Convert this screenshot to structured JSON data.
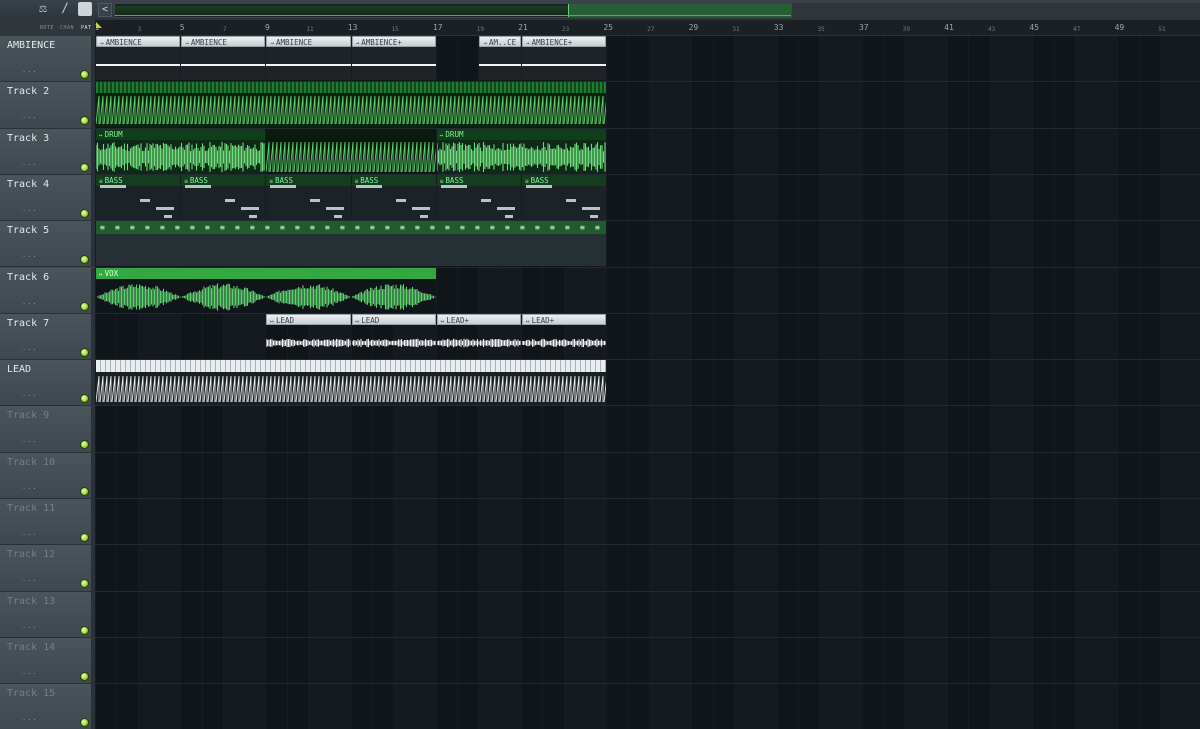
{
  "toolbar": {
    "icons": [
      "note-icon",
      "chan-icon",
      "pattern-icon"
    ],
    "note_label": "NOTE",
    "chan_label": "CHAN",
    "pat_label": "PAT",
    "overview_arrow": "<"
  },
  "ruler": {
    "major": [
      "1",
      "5",
      "9",
      "13",
      "17",
      "21",
      "25",
      "29",
      "33",
      "37",
      "41",
      "45",
      "49"
    ],
    "minor": [
      "3",
      "7",
      "11",
      "15",
      "19",
      "23",
      "27",
      "31",
      "35",
      "39",
      "43",
      "47",
      "51"
    ]
  },
  "tracks": [
    {
      "name": "AMBIENCE",
      "dots": "..."
    },
    {
      "name": "Track 2",
      "dots": "..."
    },
    {
      "name": "Track 3",
      "dots": "..."
    },
    {
      "name": "Track 4",
      "dots": "..."
    },
    {
      "name": "Track 5",
      "dots": "..."
    },
    {
      "name": "Track 6",
      "dots": "..."
    },
    {
      "name": "Track 7",
      "dots": "..."
    },
    {
      "name": "LEAD",
      "dots": "..."
    },
    {
      "name": "Track 9",
      "dots": "..."
    },
    {
      "name": "Track 10",
      "dots": "..."
    },
    {
      "name": "Track 11",
      "dots": "..."
    },
    {
      "name": "Track 12",
      "dots": "..."
    },
    {
      "name": "Track 13",
      "dots": "..."
    },
    {
      "name": "Track 14",
      "dots": "..."
    },
    {
      "name": "Track 15",
      "dots": "..."
    }
  ],
  "clips": {
    "ambience": [
      "AMBIENCE",
      "AMBIENCE",
      "AMBIENCE",
      "AMBIENCE+",
      "AM..CE",
      "AMBIENCE+"
    ],
    "drum": [
      "DRUM",
      "DRUM"
    ],
    "bass": [
      "BASS",
      "BASS",
      "BASS",
      "BASS",
      "BASS",
      "BASS"
    ],
    "chord_marker": "≡",
    "vox": "VOX",
    "lead": [
      "LEAD",
      "LEAD",
      "LEAD+",
      "LEAD+"
    ]
  },
  "colors": {
    "clip_green": "#5fd06f",
    "clip_white": "#eef1f2",
    "mute_led": "#8fd62a",
    "background": "#10151a"
  }
}
